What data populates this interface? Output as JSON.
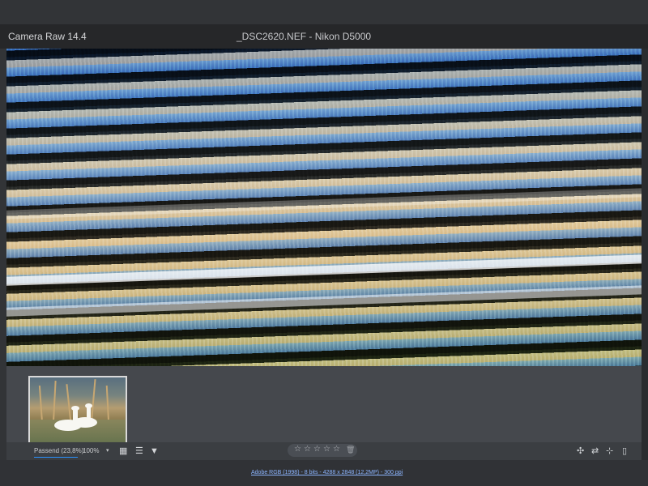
{
  "window": {
    "app_title": "Camera Raw 14.4",
    "document_title": "_DSC2620.NEF  -  Nikon D5000"
  },
  "toolbar": {
    "zoom_mode": "Passend (23,8%)",
    "zoom_value": "100%",
    "dropdown_icon": "▾",
    "filmstrip_icon": "▦",
    "sort_icon": "☰",
    "filter_icon": "▼",
    "rating_stars": [
      "☆",
      "☆",
      "☆",
      "☆",
      "☆"
    ],
    "delete_icon": "🗑",
    "right_tools": [
      "✣",
      "⇄",
      "⊹",
      "▯"
    ]
  },
  "status": {
    "image_info": "Adobe RGB (1998) - 8 bits - 4288 x 2848 (12,2MP) - 300 ppi"
  },
  "colors": {
    "accent": "#2a91ff",
    "link": "#8cb5ff"
  }
}
